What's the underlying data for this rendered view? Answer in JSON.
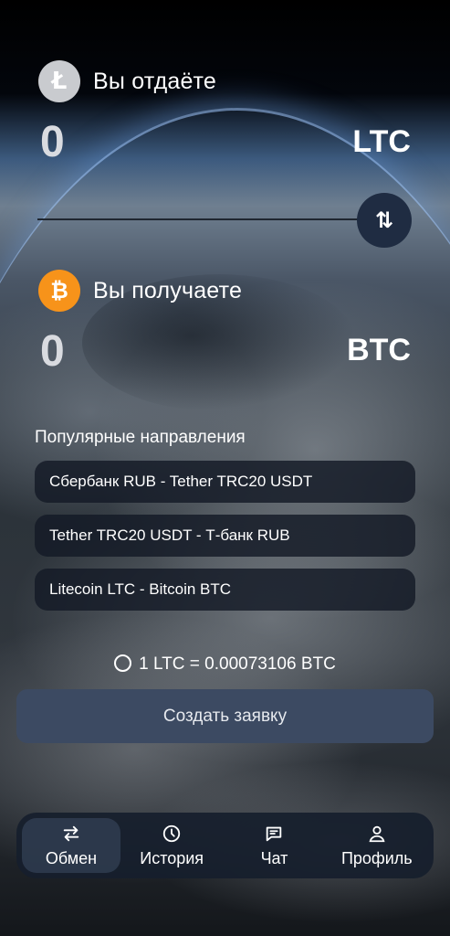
{
  "send": {
    "label": "Вы отдаёте",
    "amount": "0",
    "currency": "LTC",
    "icon": "litecoin-icon",
    "icon_glyph": "Ł",
    "color": "#c9cbcf"
  },
  "swap": {
    "icon": "swap-arrows-icon",
    "glyph": "⇅"
  },
  "receive": {
    "label": "Вы получаете",
    "amount": "0",
    "currency": "BTC",
    "icon": "bitcoin-icon",
    "icon_glyph": "₿",
    "color": "#f7931a"
  },
  "popular": {
    "title": "Популярные направления",
    "routes": [
      {
        "label": "Сбербанк RUB - Tether TRC20 USDT"
      },
      {
        "label": "Tether TRC20 USDT - Т-банк RUB"
      },
      {
        "label": "Litecoin LTC - Bitcoin BTC"
      }
    ]
  },
  "rate": {
    "text": "1 LTC = 0.00073106 BTC"
  },
  "actions": {
    "create_label": "Создать заявку"
  },
  "tabbar": {
    "tabs": [
      {
        "label": "Обмен",
        "icon": "exchange-icon",
        "active": true
      },
      {
        "label": "История",
        "icon": "clock-icon",
        "active": false
      },
      {
        "label": "Чат",
        "icon": "chat-icon",
        "active": false
      },
      {
        "label": "Профиль",
        "icon": "user-icon",
        "active": false
      }
    ]
  }
}
